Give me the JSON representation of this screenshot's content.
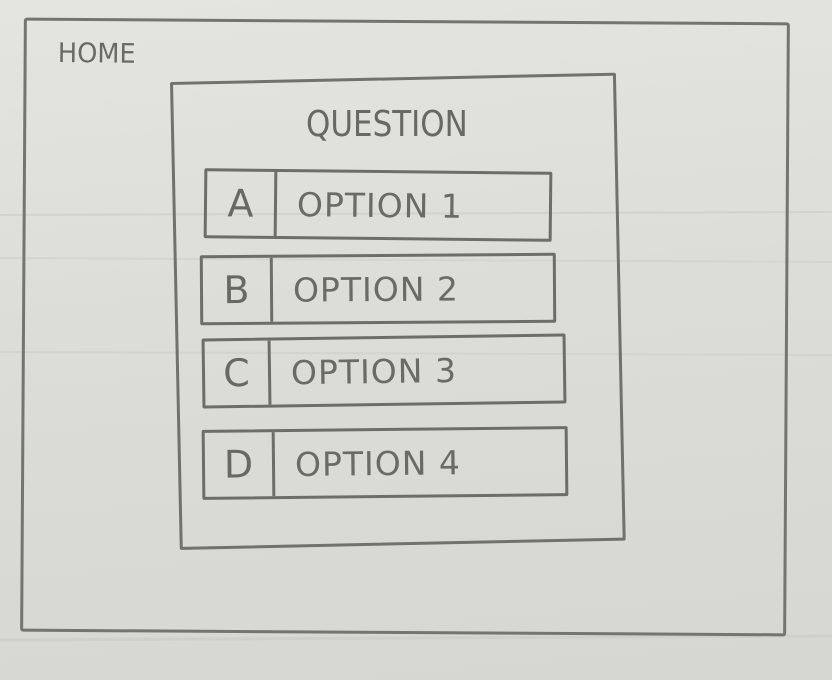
{
  "page": {
    "home_label": "HOME"
  },
  "quiz": {
    "question": "QUESTION",
    "options": [
      {
        "letter": "A",
        "label": "OPTION 1"
      },
      {
        "letter": "B",
        "label": "OPTION 2"
      },
      {
        "letter": "C",
        "label": "OPTION 3"
      },
      {
        "letter": "D",
        "label": "OPTION 4"
      }
    ]
  },
  "colors": {
    "paper": "#dcdcd8",
    "pencil": "#6e6e6a"
  }
}
